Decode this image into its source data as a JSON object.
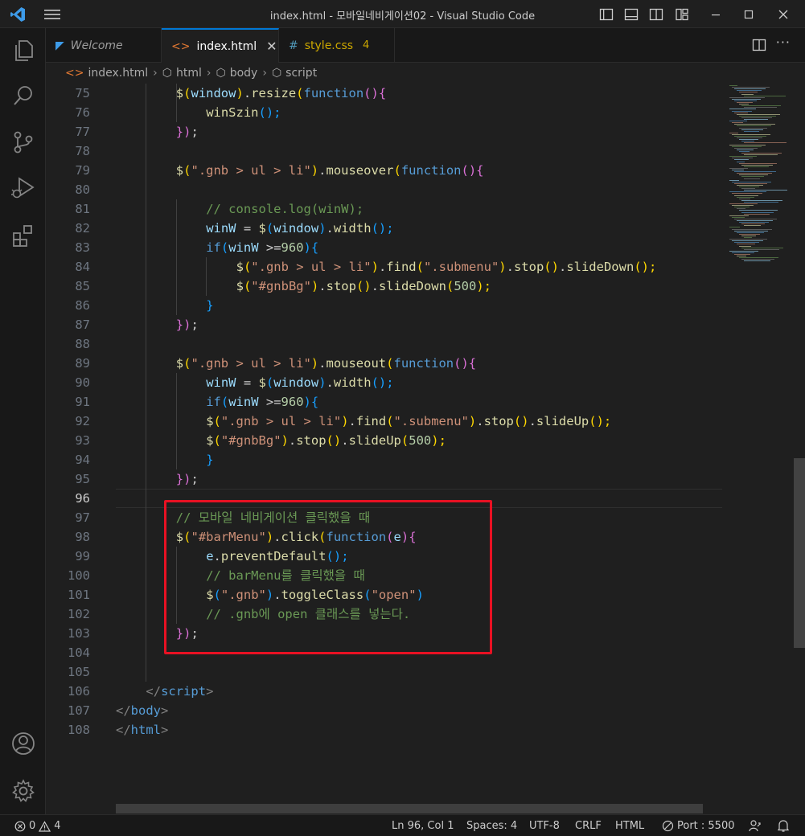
{
  "window": {
    "title": "index.html - 모바일네비게이션02 - Visual Studio Code"
  },
  "tabs": [
    {
      "label": "Welcome"
    },
    {
      "label": "index.html",
      "close": "✕"
    },
    {
      "label": "style.css",
      "badge": "4"
    }
  ],
  "breadcrumb": [
    "index.html",
    "html",
    "body",
    "script"
  ],
  "editor": {
    "current_line": "96",
    "lines": [
      {
        "n": "75"
      },
      {
        "n": "76"
      },
      {
        "n": "77"
      },
      {
        "n": "78"
      },
      {
        "n": "79"
      },
      {
        "n": "80"
      },
      {
        "n": "81"
      },
      {
        "n": "82"
      },
      {
        "n": "83"
      },
      {
        "n": "84"
      },
      {
        "n": "85"
      },
      {
        "n": "86"
      },
      {
        "n": "87"
      },
      {
        "n": "88"
      },
      {
        "n": "89"
      },
      {
        "n": "90"
      },
      {
        "n": "91"
      },
      {
        "n": "92"
      },
      {
        "n": "93"
      },
      {
        "n": "94"
      },
      {
        "n": "95"
      },
      {
        "n": "96"
      },
      {
        "n": "97"
      },
      {
        "n": "98"
      },
      {
        "n": "99"
      },
      {
        "n": "100"
      },
      {
        "n": "101"
      },
      {
        "n": "102"
      },
      {
        "n": "103"
      },
      {
        "n": "104"
      },
      {
        "n": "105"
      },
      {
        "n": "106"
      },
      {
        "n": "107"
      },
      {
        "n": "108"
      }
    ],
    "code": {
      "l75": [
        [
          "$",
          "f"
        ],
        [
          "(",
          "p1"
        ],
        [
          "window",
          "v"
        ],
        [
          ")",
          "p1"
        ],
        [
          ".",
          ""
        ],
        [
          "resize",
          "f"
        ],
        [
          "(",
          "p1"
        ],
        [
          "function",
          "k"
        ],
        [
          "(){",
          "p2"
        ]
      ],
      "l76": [
        [
          "winSzin",
          "f"
        ],
        [
          "();",
          "p3"
        ]
      ],
      "l77": [
        [
          "})",
          "p2"
        ],
        [
          ";",
          ""
        ]
      ],
      "l79": [
        [
          "$",
          "f"
        ],
        [
          "(",
          "p1"
        ],
        [
          "\".gnb > ul > li\"",
          "s"
        ],
        [
          ")",
          "p1"
        ],
        [
          ".",
          ""
        ],
        [
          "mouseover",
          "f"
        ],
        [
          "(",
          "p1"
        ],
        [
          "function",
          "k"
        ],
        [
          "(){",
          "p2"
        ]
      ],
      "l81": [
        [
          "// console.log(winW);",
          "c"
        ]
      ],
      "l82": [
        [
          "winW",
          "v"
        ],
        [
          " = ",
          ""
        ],
        [
          "$",
          "f"
        ],
        [
          "(",
          "p3"
        ],
        [
          "window",
          "v"
        ],
        [
          ")",
          "p3"
        ],
        [
          ".",
          ""
        ],
        [
          "width",
          "f"
        ],
        [
          "();",
          "p3"
        ]
      ],
      "l83": [
        [
          "if",
          "k"
        ],
        [
          "(",
          "p3"
        ],
        [
          "winW",
          "v"
        ],
        [
          " >=",
          ""
        ],
        [
          "960",
          "n"
        ],
        [
          ")",
          "p3"
        ],
        [
          "{",
          "p3"
        ]
      ],
      "l84": [
        [
          "$",
          "f"
        ],
        [
          "(",
          "p1"
        ],
        [
          "\".gnb > ul > li\"",
          "s"
        ],
        [
          ")",
          "p1"
        ],
        [
          ".",
          ""
        ],
        [
          "find",
          "f"
        ],
        [
          "(",
          "p1"
        ],
        [
          "\".submenu\"",
          "s"
        ],
        [
          ")",
          "p1"
        ],
        [
          ".",
          ""
        ],
        [
          "stop",
          "f"
        ],
        [
          "()",
          "p1"
        ],
        [
          ".",
          ""
        ],
        [
          "slideDown",
          "f"
        ],
        [
          "();",
          "p1"
        ]
      ],
      "l85": [
        [
          "$",
          "f"
        ],
        [
          "(",
          "p1"
        ],
        [
          "\"#gnbBg\"",
          "s"
        ],
        [
          ")",
          "p1"
        ],
        [
          ".",
          ""
        ],
        [
          "stop",
          "f"
        ],
        [
          "()",
          "p1"
        ],
        [
          ".",
          ""
        ],
        [
          "slideDown",
          "f"
        ],
        [
          "(",
          "p1"
        ],
        [
          "500",
          "n"
        ],
        [
          ");",
          "p1"
        ]
      ],
      "l86": [
        [
          "}",
          "p3"
        ]
      ],
      "l87": [
        [
          "})",
          "p2"
        ],
        [
          ";",
          ""
        ]
      ],
      "l89": [
        [
          "$",
          "f"
        ],
        [
          "(",
          "p1"
        ],
        [
          "\".gnb > ul > li\"",
          "s"
        ],
        [
          ")",
          "p1"
        ],
        [
          ".",
          ""
        ],
        [
          "mouseout",
          "f"
        ],
        [
          "(",
          "p1"
        ],
        [
          "function",
          "k"
        ],
        [
          "(){",
          "p2"
        ]
      ],
      "l90": [
        [
          "winW",
          "v"
        ],
        [
          " = ",
          ""
        ],
        [
          "$",
          "f"
        ],
        [
          "(",
          "p3"
        ],
        [
          "window",
          "v"
        ],
        [
          ")",
          "p3"
        ],
        [
          ".",
          ""
        ],
        [
          "width",
          "f"
        ],
        [
          "();",
          "p3"
        ]
      ],
      "l91": [
        [
          "if",
          "k"
        ],
        [
          "(",
          "p3"
        ],
        [
          "winW",
          "v"
        ],
        [
          " >=",
          ""
        ],
        [
          "960",
          "n"
        ],
        [
          ")",
          "p3"
        ],
        [
          "{",
          "p3"
        ]
      ],
      "l92": [
        [
          "$",
          "f"
        ],
        [
          "(",
          "p1"
        ],
        [
          "\".gnb > ul > li\"",
          "s"
        ],
        [
          ")",
          "p1"
        ],
        [
          ".",
          ""
        ],
        [
          "find",
          "f"
        ],
        [
          "(",
          "p1"
        ],
        [
          "\".submenu\"",
          "s"
        ],
        [
          ")",
          "p1"
        ],
        [
          ".",
          ""
        ],
        [
          "stop",
          "f"
        ],
        [
          "()",
          "p1"
        ],
        [
          ".",
          ""
        ],
        [
          "slideUp",
          "f"
        ],
        [
          "();",
          "p1"
        ]
      ],
      "l93": [
        [
          "$",
          "f"
        ],
        [
          "(",
          "p1"
        ],
        [
          "\"#gnbBg\"",
          "s"
        ],
        [
          ")",
          "p1"
        ],
        [
          ".",
          ""
        ],
        [
          "stop",
          "f"
        ],
        [
          "()",
          "p1"
        ],
        [
          ".",
          ""
        ],
        [
          "slideUp",
          "f"
        ],
        [
          "(",
          "p1"
        ],
        [
          "500",
          "n"
        ],
        [
          ");",
          "p1"
        ]
      ],
      "l94": [
        [
          "}",
          "p3"
        ]
      ],
      "l95": [
        [
          "})",
          "p2"
        ],
        [
          ";",
          ""
        ]
      ],
      "l97": [
        [
          "// 모바일 네비게이션 클릭했을 때",
          "c"
        ]
      ],
      "l98": [
        [
          "$",
          "f"
        ],
        [
          "(",
          "p1"
        ],
        [
          "\"#barMenu\"",
          "s"
        ],
        [
          ")",
          "p1"
        ],
        [
          ".",
          ""
        ],
        [
          "click",
          "f"
        ],
        [
          "(",
          "p1"
        ],
        [
          "function",
          "k"
        ],
        [
          "(",
          "p2"
        ],
        [
          "e",
          "v"
        ],
        [
          "){",
          "p2"
        ]
      ],
      "l99": [
        [
          "e",
          "v"
        ],
        [
          ".",
          ""
        ],
        [
          "preventDefault",
          "f"
        ],
        [
          "();",
          "p3"
        ]
      ],
      "l100": [
        [
          "// barMenu를 클릭했을 때",
          "c"
        ]
      ],
      "l101": [
        [
          "$",
          "f"
        ],
        [
          "(",
          "p3"
        ],
        [
          "\".gnb\"",
          "s"
        ],
        [
          ")",
          "p3"
        ],
        [
          ".",
          ""
        ],
        [
          "toggleClass",
          "f"
        ],
        [
          "(",
          "p3"
        ],
        [
          "\"open\"",
          "s"
        ],
        [
          ")",
          "p3"
        ]
      ],
      "l102": [
        [
          "// .gnb에 open 클래스를 넣는다.",
          "c"
        ]
      ],
      "l103": [
        [
          "})",
          "p2"
        ],
        [
          ";",
          ""
        ]
      ],
      "l106": [
        [
          "</",
          "tg"
        ],
        [
          "script",
          "tn"
        ],
        [
          ">",
          "tg"
        ]
      ],
      "l107": [
        [
          "</",
          "tg"
        ],
        [
          "body",
          "tn"
        ],
        [
          ">",
          "tg"
        ]
      ],
      "l108": [
        [
          "</",
          "tg"
        ],
        [
          "html",
          "tn"
        ],
        [
          ">",
          "tg"
        ]
      ]
    }
  },
  "status": {
    "errors": "0",
    "warnings": "4",
    "position": "Ln 96, Col 1",
    "spaces": "Spaces: 4",
    "encoding": "UTF-8",
    "eol": "CRLF",
    "language": "HTML",
    "port": "Port : 5500"
  },
  "colors": {
    "accent": "#0078d4",
    "highlight_box": "#e81123",
    "warning": "#cca700"
  },
  "icons": [
    "vscode-logo-icon",
    "menu-icon",
    "explorer-icon",
    "search-icon",
    "source-control-icon",
    "run-debug-icon",
    "extensions-icon",
    "account-icon",
    "settings-gear-icon",
    "split-editor-icon",
    "more-actions-icon",
    "error-icon",
    "warning-icon",
    "port-icon",
    "feedback-icon",
    "bell-icon"
  ]
}
